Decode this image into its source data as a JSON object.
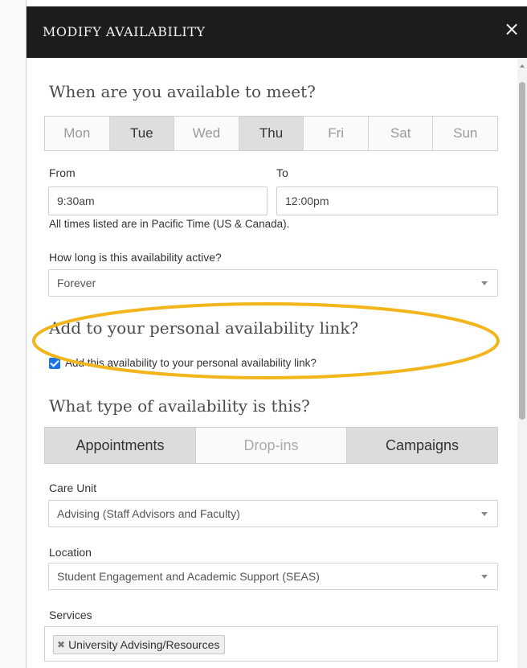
{
  "modal": {
    "title": "MODIFY AVAILABILITY",
    "close": "×"
  },
  "when": {
    "heading": "When are you available to meet?",
    "days": [
      {
        "label": "Mon",
        "selected": false
      },
      {
        "label": "Tue",
        "selected": true
      },
      {
        "label": "Wed",
        "selected": false
      },
      {
        "label": "Thu",
        "selected": true
      },
      {
        "label": "Fri",
        "selected": false
      },
      {
        "label": "Sat",
        "selected": false
      },
      {
        "label": "Sun",
        "selected": false
      }
    ],
    "from_label": "From",
    "from_value": "9:30am",
    "to_label": "To",
    "to_value": "12:00pm",
    "timezone_note": "All times listed are in Pacific Time (US & Canada).",
    "active_label": "How long is this availability active?",
    "active_value": "Forever"
  },
  "personal_link": {
    "heading": "Add to your personal availability link?",
    "checkbox_label": "Add this availability to your personal availability link?",
    "checked": true
  },
  "type": {
    "heading": "What type of availability is this?",
    "options": [
      {
        "label": "Appointments",
        "selected": true
      },
      {
        "label": "Drop-ins",
        "selected": false
      },
      {
        "label": "Campaigns",
        "selected": true
      }
    ]
  },
  "care_unit": {
    "label": "Care Unit",
    "value": "Advising (Staff Advisors and Faculty)"
  },
  "location": {
    "label": "Location",
    "value": "Student Engagement and Academic Support (SEAS)"
  },
  "services": {
    "label": "Services",
    "tags": [
      "University Advising/Resources"
    ]
  },
  "colors": {
    "header_bg": "#1c1c1c",
    "selected_bg": "#dedede",
    "checkbox": "#1a73e8",
    "highlight_ring": "#f2b51c"
  }
}
